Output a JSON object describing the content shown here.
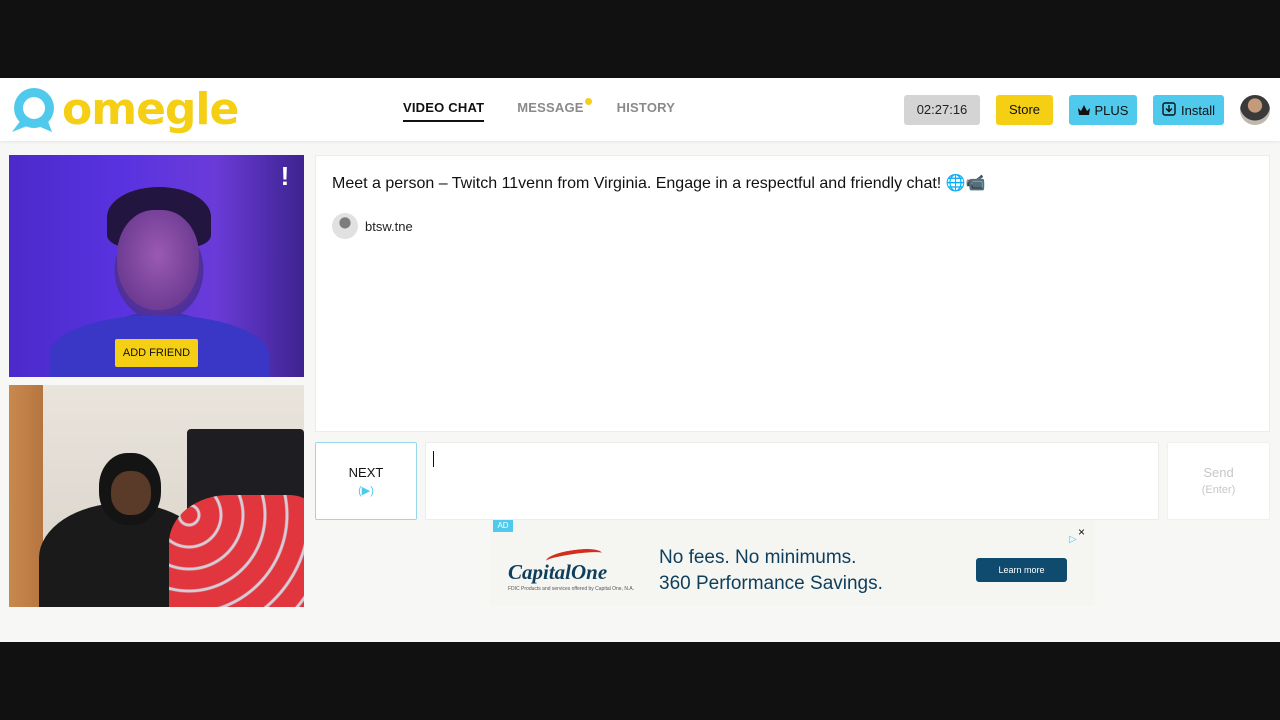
{
  "header": {
    "logo_text": "omegle",
    "nav": [
      {
        "label": "VIDEO CHAT",
        "active": true
      },
      {
        "label": "MESSAGE",
        "active": false,
        "has_dot": true
      },
      {
        "label": "HISTORY",
        "active": false
      }
    ],
    "timer": "02:27:16",
    "store_label": "Store",
    "plus_label": "PLUS",
    "install_label": "Install"
  },
  "stranger_video": {
    "report_label": "!",
    "add_friend_label": "ADD FRIEND"
  },
  "chat": {
    "intro": "Meet a person – Twitch 11venn from Virginia. Engage in a respectful and friendly chat! 🌐📹",
    "username": "btsw.tne",
    "input_value": ""
  },
  "controls": {
    "next_label": "NEXT",
    "next_hint": "(▶)",
    "send_label": "Send",
    "send_hint": "(Enter)"
  },
  "ad": {
    "badge": "AD",
    "brand": "CapitalOne",
    "fine_print": "FDIC Products and services offered by Capital One, N.A.",
    "headline1": "No fees. No minimums.",
    "headline2": "360 Performance Savings.",
    "cta": "Learn more",
    "close": "×"
  },
  "colors": {
    "brand_yellow": "#f4cf14",
    "accent_blue": "#4fc9ec",
    "ad_navy": "#0f4b6e"
  }
}
